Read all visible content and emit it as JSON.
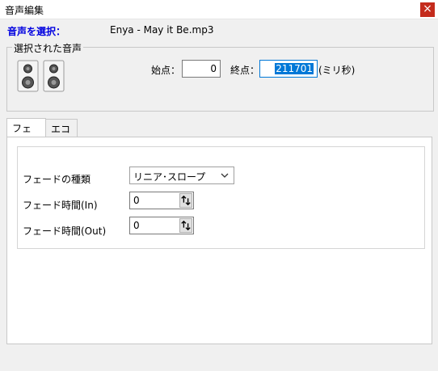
{
  "window": {
    "title": "音声編集",
    "close_glyph": "×"
  },
  "select": {
    "label": "音声を選択：",
    "filename": "Enya - May it Be.mp3"
  },
  "selected_group": {
    "legend": "選択された音声",
    "icon": "speaker-icon",
    "start_label": "始点：",
    "start_value": "0",
    "end_label": "終点：",
    "end_value": "211701",
    "unit_label": "(ミリ秒)"
  },
  "tabs": [
    {
      "label": "フェード",
      "active": true
    },
    {
      "label": "エコー",
      "active": false
    }
  ],
  "fade": {
    "type_label": "フェードの種類",
    "type_value": "リニア･スロープ",
    "in_label": "フェード時間(In)",
    "in_value": "0",
    "out_label": "フェード時間(Out)",
    "out_value": "0"
  },
  "colors": {
    "accent": "#0078d7",
    "select_label": "#0000e0",
    "close": "#c42b1c"
  }
}
